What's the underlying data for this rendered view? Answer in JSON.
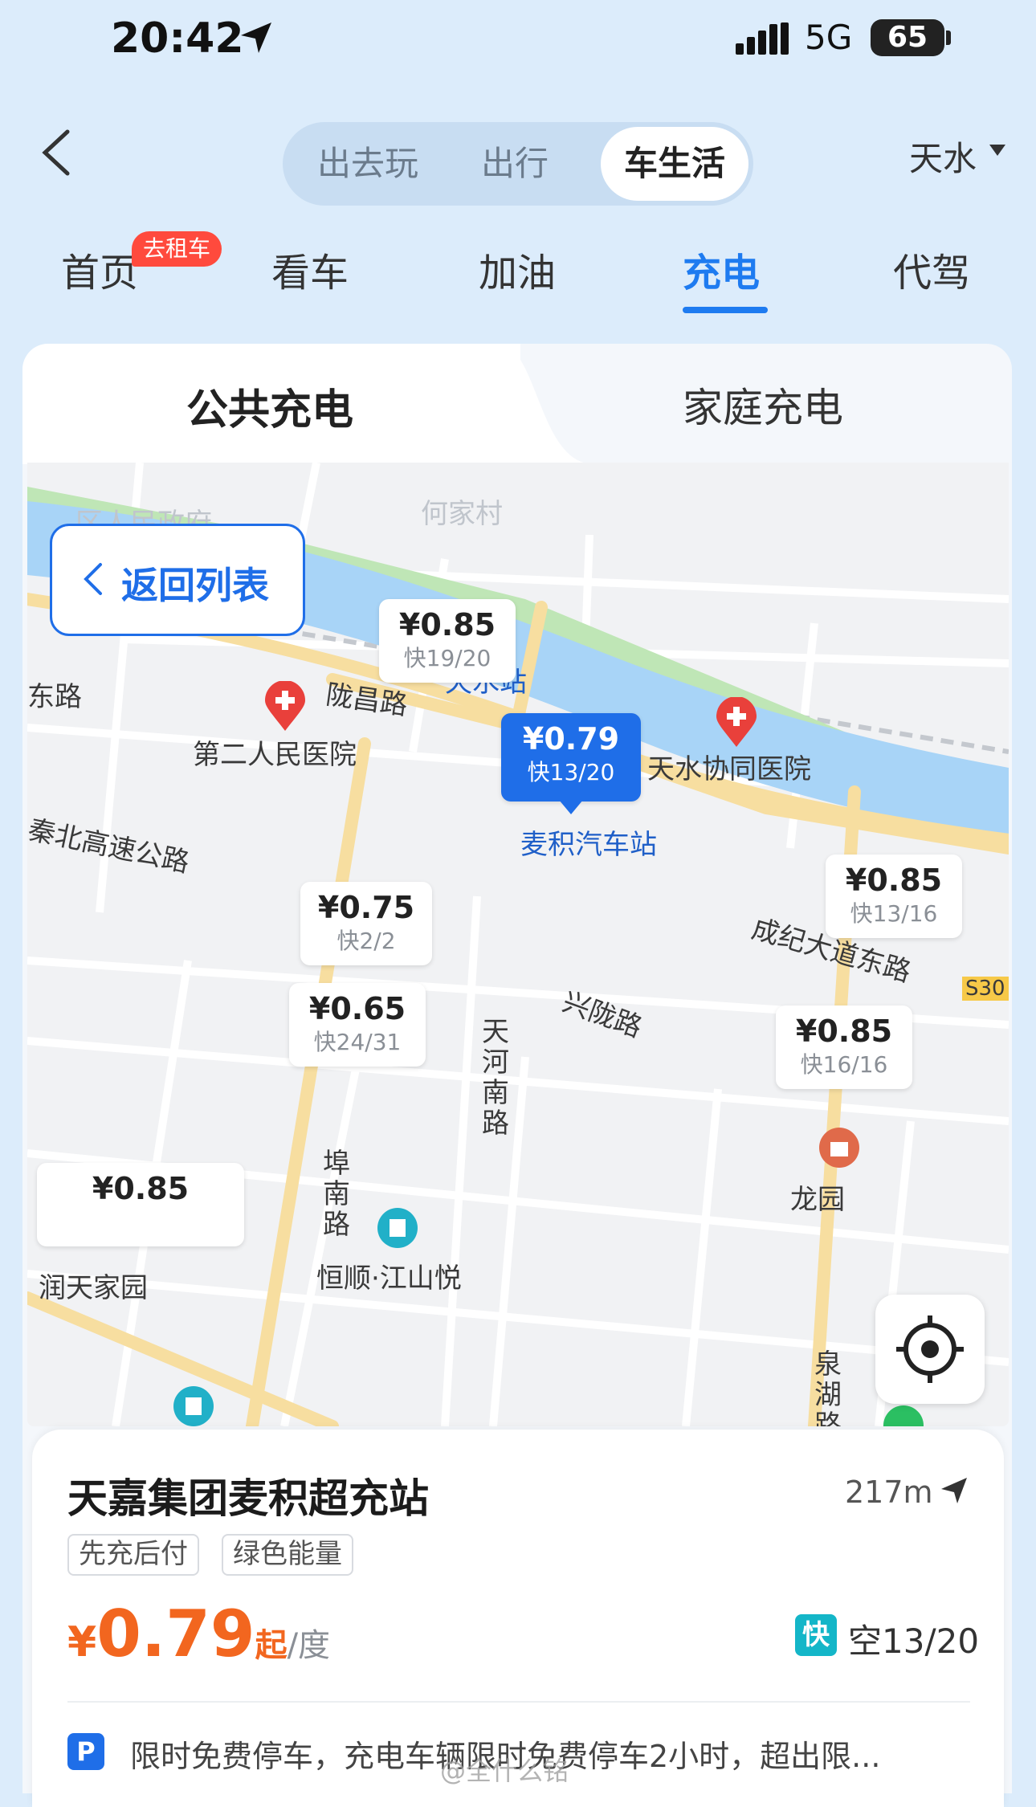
{
  "status_bar": {
    "time": "20:42",
    "network": "5G",
    "battery": "65"
  },
  "top_nav": {
    "segments": [
      "出去玩",
      "出行",
      "车生活"
    ],
    "active_segment": "车生活",
    "city": "天水"
  },
  "tabs": {
    "items": [
      "首页",
      "看车",
      "加油",
      "充电",
      "代驾"
    ],
    "active": "充电",
    "home_badge": "去租车"
  },
  "panel_tabs": {
    "left": "公共充电",
    "right": "家庭充电"
  },
  "map": {
    "back_to_list": "返回列表",
    "labels": {
      "district_gov": "区人民政府",
      "village": "何家村",
      "east_road": "东路",
      "longchang_road": "陇昌路",
      "tianshui_station": "天水站",
      "hospital2": "第二人民医院",
      "xietong_hospital": "天水协同医院",
      "maiji_bus": "麦积汽车站",
      "highway": "秦北高速公路",
      "chengji_road": "成纪大道东路",
      "s30": "S30",
      "xinglong_road": "兴陇路",
      "tianhe_road": "天河南路",
      "bunan_road": "埠南路",
      "hengshun": "恒顺·江山悦",
      "longyuan": "龙园",
      "runtian": "润天家园",
      "quanhu_road": "泉湖路"
    },
    "pins": [
      {
        "price": "¥0.85",
        "fast": "快19/20"
      },
      {
        "price": "¥0.79",
        "fast": "快13/20",
        "selected": true
      },
      {
        "price": "¥0.85",
        "fast": "快13/16"
      },
      {
        "price": "¥0.75",
        "fast": "快2/2"
      },
      {
        "price": "¥0.65",
        "fast": "快24/31"
      },
      {
        "price": "¥0.85",
        "fast": "快16/16"
      },
      {
        "price": "¥0.85",
        "fast": ""
      }
    ]
  },
  "station": {
    "name": "天嘉集团麦积超充站",
    "distance": "217m",
    "tags": [
      "先充后付",
      "绿色能量"
    ],
    "price_yen": "¥",
    "price_value": "0.79",
    "price_suffix": "起",
    "price_unit": "/度",
    "fast_label": "快",
    "available": "空13/20",
    "parking_badge": "P",
    "parking_text": "限时免费停车，充电车辆限时免费停车2小时，超出限..."
  },
  "watermark": "@全什么铭",
  "colors": {
    "accent": "#1e7bf0",
    "price": "#f2661f",
    "badge": "#ff4a3d",
    "fast": "#14b6c8"
  }
}
